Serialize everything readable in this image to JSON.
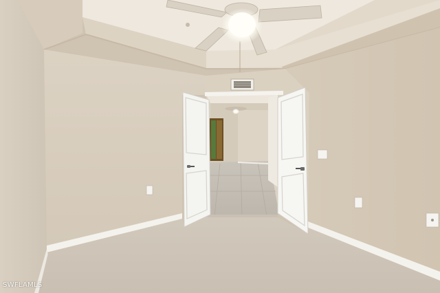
{
  "photo": {
    "watermark": "SWFLAMLS"
  },
  "colors": {
    "wall": "#d8cdbd",
    "ceiling": "#e4dccf",
    "carpet": "#cfc4b6",
    "trim": "#f6f4ef",
    "door": "#f5f5f2",
    "tile": "#c8c2b8"
  }
}
